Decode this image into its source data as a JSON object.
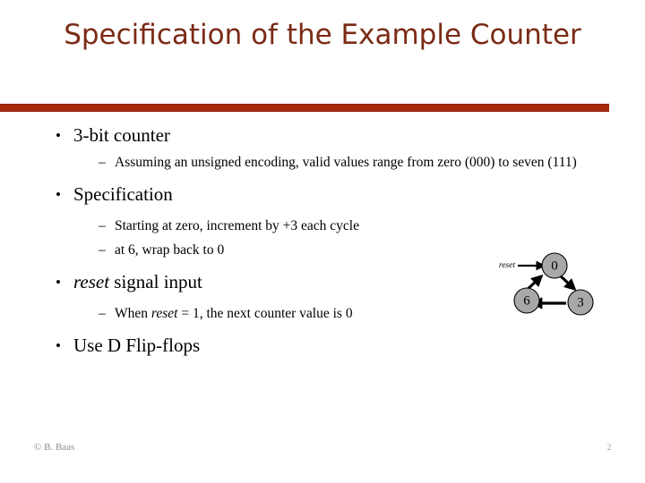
{
  "slide": {
    "title": "Specification of the Example Counter",
    "accent_color": "#7B2B16",
    "divider_color": "#A62A0B",
    "background_color": "#FFFFFF"
  },
  "body": {
    "bullet_marker": "•",
    "sub_marker": "–",
    "items": [
      {
        "level": 1,
        "text": "3-bit counter"
      },
      {
        "level": 2,
        "text": "Assuming an unsigned encoding, valid values range from zero (000) to seven (111)"
      },
      {
        "level": 1,
        "text": "Specification"
      },
      {
        "level": 2,
        "text": "Starting at zero, increment by +3 each cycle"
      },
      {
        "level": 2,
        "text": "at 6, wrap back to 0"
      },
      {
        "level": 1,
        "text_italic": "reset",
        "text_rest": " signal input"
      },
      {
        "level": 2,
        "text_pre": "When ",
        "text_italic": "reset",
        "text_post": " = 1, the next counter value is 0"
      },
      {
        "level": 1,
        "text": "Use D Flip-flops"
      }
    ]
  },
  "state_diagram": {
    "input_label": "reset",
    "node_fill_color": "#A8A8A8",
    "states": [
      {
        "name": "0",
        "label": "0"
      },
      {
        "name": "3",
        "label": "3"
      },
      {
        "name": "6",
        "label": "6"
      }
    ],
    "transitions": [
      {
        "from": "0",
        "to": "3"
      },
      {
        "from": "3",
        "to": "6"
      },
      {
        "from": "6",
        "to": "0"
      }
    ]
  },
  "footer": {
    "copyright": "© B. Baas",
    "page_number": "2"
  }
}
